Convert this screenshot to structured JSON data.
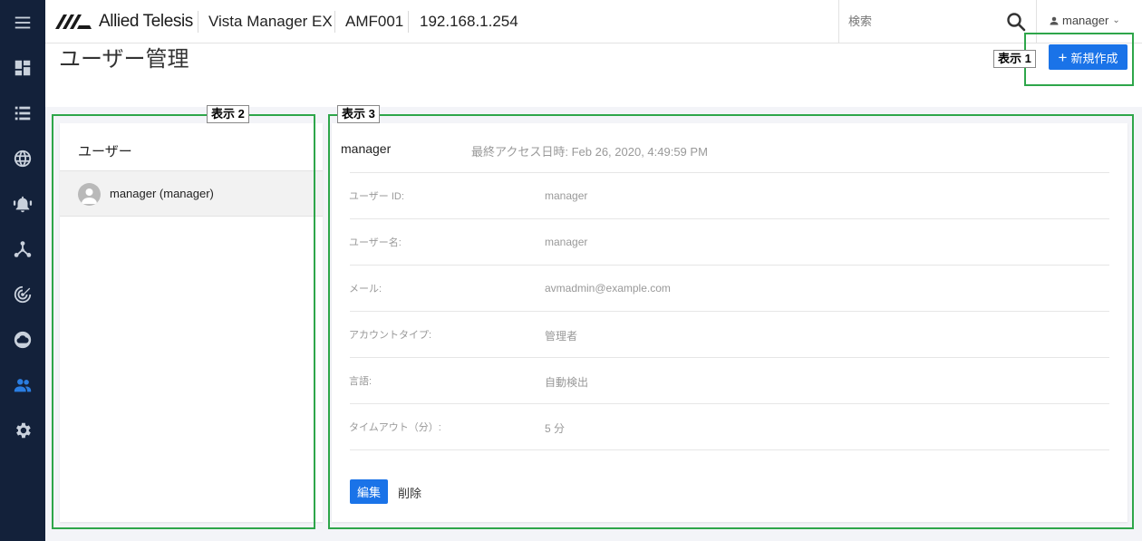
{
  "brand": {
    "logo_text": "Allied Telesis"
  },
  "topbar": {
    "product": "Vista Manager EX",
    "device": "AMF001",
    "ip": "192.168.1.254",
    "search_placeholder": "検索",
    "user": "manager"
  },
  "sidebar": {
    "items": [
      {
        "name": "menu-icon",
        "active": false
      },
      {
        "name": "dashboard-icon",
        "active": false
      },
      {
        "name": "list-icon",
        "active": false
      },
      {
        "name": "globe-icon",
        "active": false
      },
      {
        "name": "alarm-bell-icon",
        "active": false
      },
      {
        "name": "network-topology-icon",
        "active": false
      },
      {
        "name": "radar-icon",
        "active": false
      },
      {
        "name": "cloud-icon",
        "active": false
      },
      {
        "name": "users-icon",
        "active": true
      },
      {
        "name": "gear-icon",
        "active": false
      }
    ]
  },
  "page": {
    "title": "ユーザー管理",
    "new_button": "新規作成"
  },
  "user_list": {
    "title": "ユーザー",
    "rows": [
      {
        "label": "manager (manager)"
      }
    ]
  },
  "detail": {
    "name": "manager",
    "last_access": "最終アクセス日時: Feb 26, 2020, 4:49:59 PM",
    "fields": [
      {
        "label": "ユーザー ID:",
        "value": "manager"
      },
      {
        "label": "ユーザー名:",
        "value": "manager"
      },
      {
        "label": "メール:",
        "value": "avmadmin@example.com"
      },
      {
        "label": "アカウントタイプ:",
        "value": "管理者"
      },
      {
        "label": "言語:",
        "value": "自動検出"
      },
      {
        "label": "タイムアウト（分）:",
        "value": "5 分"
      }
    ],
    "edit_button": "編集",
    "delete_button": "削除"
  },
  "annotations": {
    "label1": "表示 1",
    "label2": "表示 2",
    "label3": "表示 3"
  },
  "colors": {
    "sidebar_bg": "#13213a",
    "accent": "#1a73e8",
    "annotation": "#2ea64a"
  }
}
